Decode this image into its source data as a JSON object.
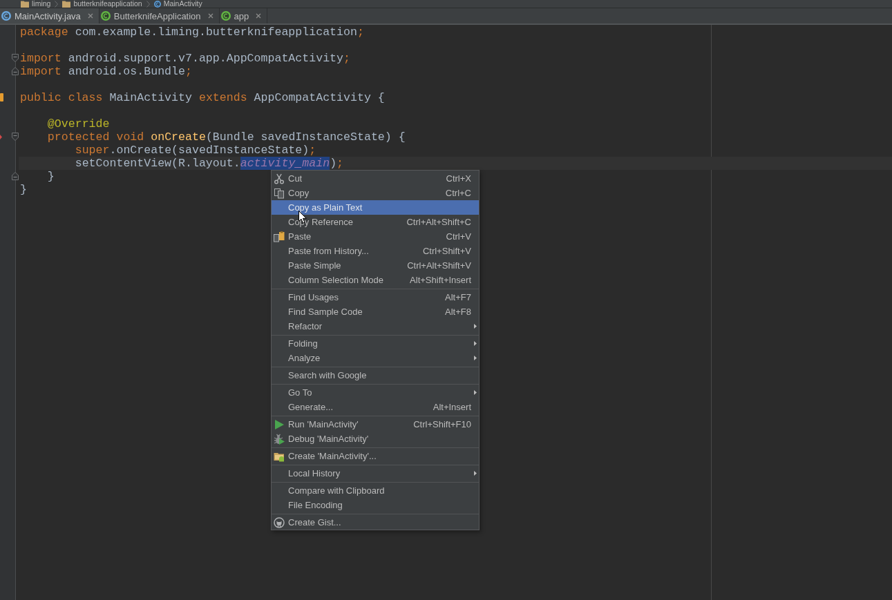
{
  "breadcrumbs": [
    {
      "label": "liming",
      "kind": "package"
    },
    {
      "label": "butterknifeapplication",
      "kind": "package"
    },
    {
      "label": "MainActivity",
      "kind": "class"
    }
  ],
  "tabs": [
    {
      "label": "MainActivity.java",
      "kind": "class",
      "selected": true
    },
    {
      "label": "ButterknifeApplication",
      "kind": "gradle",
      "selected": false
    },
    {
      "label": "app",
      "kind": "gradle",
      "selected": false
    }
  ],
  "editor": {
    "lines": [
      {
        "kind": "code",
        "current": false,
        "tokens": [
          {
            "kind": "keyword",
            "text": "package",
            "selected": false
          },
          {
            "kind": "plain",
            "text": " com.example.liming.butterknifeapplication",
            "selected": false
          },
          {
            "kind": "keyword",
            "text": ";",
            "selected": false
          }
        ]
      },
      {
        "kind": "blank",
        "current": false
      },
      {
        "kind": "code",
        "current": false,
        "gutter_icons": [
          {
            "kind": "fold_start"
          }
        ],
        "tokens": [
          {
            "kind": "keyword",
            "text": "import",
            "selected": false
          },
          {
            "kind": "plain",
            "text": " android.support.v7.app.AppCompatActivity",
            "selected": false
          },
          {
            "kind": "keyword",
            "text": ";",
            "selected": false
          }
        ]
      },
      {
        "kind": "code",
        "current": false,
        "gutter_icons": [
          {
            "kind": "fold_end"
          }
        ],
        "tokens": [
          {
            "kind": "keyword",
            "text": "import",
            "selected": false
          },
          {
            "kind": "plain",
            "text": " android.os.Bundle",
            "selected": false
          },
          {
            "kind": "keyword",
            "text": ";",
            "selected": false
          }
        ]
      },
      {
        "kind": "blank",
        "current": false
      },
      {
        "kind": "code",
        "current": false,
        "gutter_icons": [
          {
            "kind": "implemented"
          }
        ],
        "tokens": [
          {
            "kind": "keyword",
            "text": "public class",
            "selected": false
          },
          {
            "kind": "plain",
            "text": " MainActivity ",
            "selected": false
          },
          {
            "kind": "keyword",
            "text": "extends",
            "selected": false
          },
          {
            "kind": "plain",
            "text": " AppCompatActivity {",
            "selected": false
          }
        ]
      },
      {
        "kind": "blank",
        "current": false
      },
      {
        "kind": "code",
        "current": false,
        "tokens": [
          {
            "kind": "annotation",
            "text": "    @Override",
            "selected": false
          }
        ]
      },
      {
        "kind": "code",
        "current": false,
        "gutter_icons": [
          {
            "kind": "overrides"
          },
          {
            "kind": "fold_start"
          }
        ],
        "tokens": [
          {
            "kind": "keyword",
            "text": "    protected void ",
            "selected": false
          },
          {
            "kind": "method",
            "text": "onCreate",
            "selected": false
          },
          {
            "kind": "plain",
            "text": "(Bundle savedInstanceState) {",
            "selected": false
          }
        ]
      },
      {
        "kind": "code",
        "current": false,
        "tokens": [
          {
            "kind": "keyword",
            "text": "        super",
            "selected": false
          },
          {
            "kind": "plain",
            "text": ".onCreate(savedInstanceState)",
            "selected": false
          },
          {
            "kind": "keyword",
            "text": ";",
            "selected": false
          }
        ]
      },
      {
        "kind": "code",
        "current": true,
        "tokens": [
          {
            "kind": "plain",
            "text": "        setContentView(R.layout.",
            "selected": false
          },
          {
            "kind": "field",
            "text": "activity_main",
            "selected": true
          },
          {
            "kind": "plain",
            "text": ")",
            "selected": false
          },
          {
            "kind": "keyword",
            "text": ";",
            "selected": false
          }
        ]
      },
      {
        "kind": "code",
        "current": false,
        "gutter_icons": [
          {
            "kind": "fold_end"
          }
        ],
        "tokens": [
          {
            "kind": "plain",
            "text": "    }",
            "selected": false
          }
        ]
      },
      {
        "kind": "code",
        "current": false,
        "tokens": [
          {
            "kind": "plain",
            "text": "}",
            "selected": false
          }
        ]
      }
    ]
  },
  "context_menu": {
    "groups": [
      {
        "items": [
          {
            "label": "Cut",
            "shortcut": "Ctrl+X",
            "submenu": false,
            "selected": false
          },
          {
            "label": "Copy",
            "shortcut": "Ctrl+C",
            "submenu": false,
            "selected": false
          },
          {
            "label": "Copy as Plain Text",
            "submenu": false,
            "selected": true
          },
          {
            "label": "Copy Reference",
            "shortcut": "Ctrl+Alt+Shift+C",
            "submenu": false,
            "selected": false
          },
          {
            "label": "Paste",
            "shortcut": "Ctrl+V",
            "submenu": false,
            "selected": false
          },
          {
            "label": "Paste from History...",
            "shortcut": "Ctrl+Shift+V",
            "submenu": false,
            "selected": false
          },
          {
            "label": "Paste Simple",
            "shortcut": "Ctrl+Alt+Shift+V",
            "submenu": false,
            "selected": false
          },
          {
            "label": "Column Selection Mode",
            "shortcut": "Alt+Shift+Insert",
            "submenu": false,
            "selected": false
          }
        ]
      },
      {
        "items": [
          {
            "label": "Find Usages",
            "shortcut": "Alt+F7",
            "submenu": false,
            "selected": false
          },
          {
            "label": "Find Sample Code",
            "shortcut": "Alt+F8",
            "submenu": false,
            "selected": false
          },
          {
            "label": "Refactor",
            "submenu": true,
            "selected": false
          }
        ]
      },
      {
        "items": [
          {
            "label": "Folding",
            "submenu": true,
            "selected": false
          },
          {
            "label": "Analyze",
            "submenu": true,
            "selected": false
          }
        ]
      },
      {
        "items": [
          {
            "label": "Search with Google",
            "submenu": false,
            "selected": false
          }
        ]
      },
      {
        "items": [
          {
            "label": "Go To",
            "submenu": true,
            "selected": false
          },
          {
            "label": "Generate...",
            "shortcut": "Alt+Insert",
            "submenu": false,
            "selected": false
          }
        ]
      },
      {
        "items": [
          {
            "label": "Run 'MainActivity'",
            "shortcut": "Ctrl+Shift+F10",
            "submenu": false,
            "selected": false
          },
          {
            "label": "Debug 'MainActivity'",
            "submenu": false,
            "selected": false
          }
        ]
      },
      {
        "items": [
          {
            "label": "Create 'MainActivity'...",
            "submenu": false,
            "selected": false
          }
        ]
      },
      {
        "items": [
          {
            "label": "Local History",
            "submenu": true,
            "selected": false
          }
        ]
      },
      {
        "items": [
          {
            "label": "Compare with Clipboard",
            "submenu": false,
            "selected": false
          },
          {
            "label": "File Encoding",
            "submenu": false,
            "selected": false
          }
        ]
      },
      {
        "items": [
          {
            "label": "Create Gist...",
            "submenu": false,
            "selected": false
          }
        ]
      }
    ]
  }
}
